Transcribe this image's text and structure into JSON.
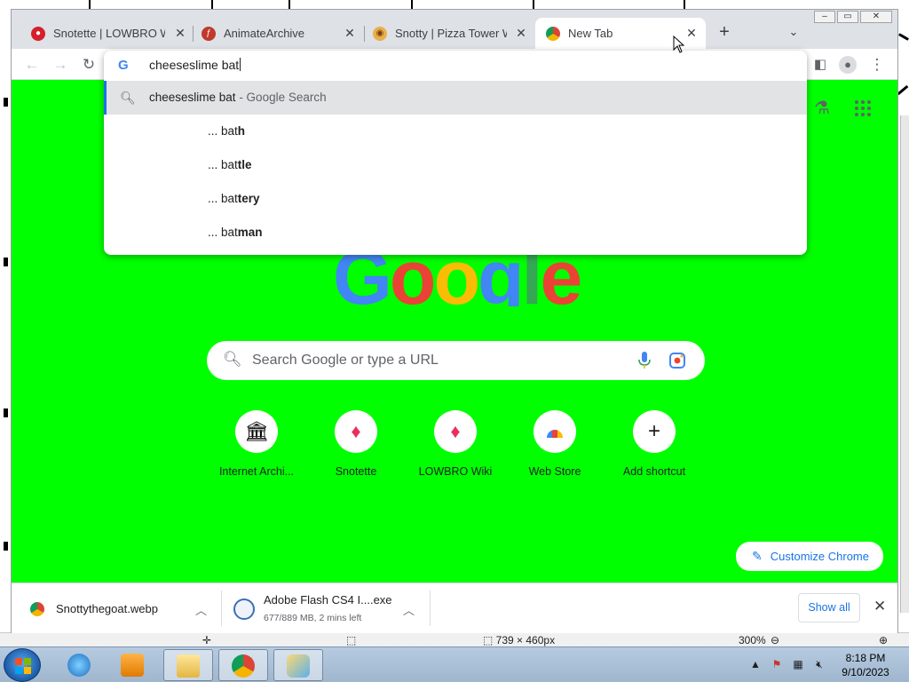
{
  "browser": {
    "tabs": [
      {
        "title": "Snotette | LOWBRO Wiki",
        "favicon": "fandom-flame-icon"
      },
      {
        "title": "AnimateArchive",
        "favicon": "flash-icon"
      },
      {
        "title": "Snotty | Pizza Tower Wiki",
        "favicon": "pizza-icon"
      },
      {
        "title": "New Tab",
        "favicon": "chrome-icon"
      }
    ],
    "new_tab_button": "+",
    "omnibox": {
      "value": "cheeseslime bat",
      "suggestions": [
        {
          "prefix": "cheeseslime bat",
          "suffix": " - Google Search"
        },
        {
          "prefix": "... bat",
          "completion": "h"
        },
        {
          "prefix": "... bat",
          "completion": "tle"
        },
        {
          "prefix": "... bat",
          "completion": "tery"
        },
        {
          "prefix": "... bat",
          "completion": "man"
        }
      ]
    }
  },
  "ntp": {
    "logo": [
      "G",
      "o",
      "o",
      "g",
      "l",
      "e"
    ],
    "logo_colors": [
      "#4285f4",
      "#ea4335",
      "#fbbc05",
      "#4285f4",
      "#34a853",
      "#ea4335"
    ],
    "search_placeholder": "Search Google or type a URL",
    "shortcuts": [
      {
        "label": "Internet Archi...",
        "icon": "archive-icon"
      },
      {
        "label": "Snotette",
        "icon": "fandom-flame-icon"
      },
      {
        "label": "LOWBRO Wiki",
        "icon": "fandom-flame-icon"
      },
      {
        "label": "Web Store",
        "icon": "webstore-icon"
      },
      {
        "label": "Add shortcut",
        "icon": "plus-icon"
      }
    ],
    "customize_label": "Customize Chrome",
    "background_color": "#00ff00"
  },
  "downloads": {
    "items": [
      {
        "name": "Snottythegoat.webp",
        "status": ""
      },
      {
        "name": "Adobe Flash CS4 I....exe",
        "status": "677/889 MB, 2 mins left"
      }
    ],
    "show_all_label": "Show all"
  },
  "background_app": {
    "dimensions": "739 × 460px",
    "zoom": "300%"
  },
  "taskbar": {
    "time": "8:18 PM",
    "date": "9/10/2023"
  }
}
